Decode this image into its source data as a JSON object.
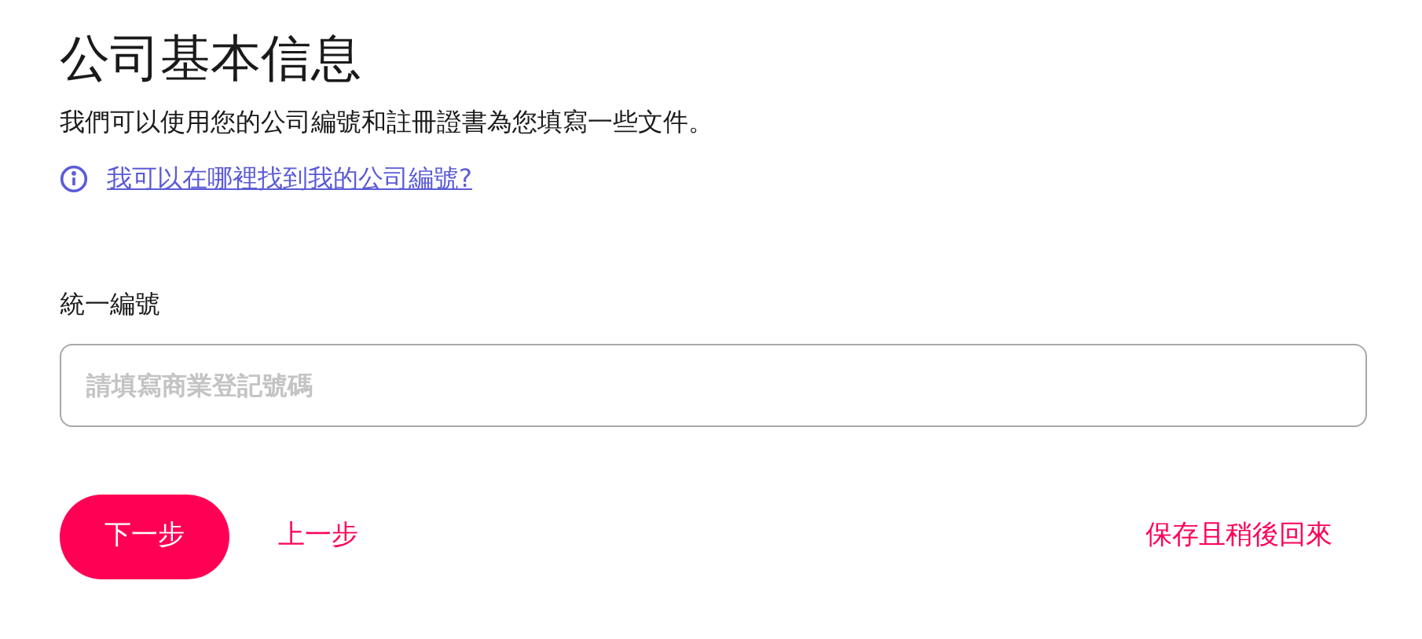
{
  "title": "公司基本信息",
  "description": "我們可以使用您的公司編號和註冊證書為您填寫一些文件。",
  "help_link": "我可以在哪裡找到我的公司編號?",
  "field": {
    "label": "統一編號",
    "placeholder": "請填寫商業登記號碼"
  },
  "buttons": {
    "next": "下一步",
    "back": "上一步",
    "save_later": "保存且稍後回來"
  }
}
